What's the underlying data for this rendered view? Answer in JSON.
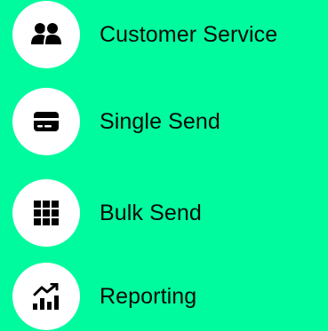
{
  "menu": {
    "items": [
      {
        "label": "Customer Service",
        "icon": "customer-service-icon"
      },
      {
        "label": "Single Send",
        "icon": "credit-card-icon"
      },
      {
        "label": "Bulk Send",
        "icon": "grid-icon"
      },
      {
        "label": "Reporting",
        "icon": "analytics-chart-icon"
      }
    ]
  },
  "colors": {
    "background": "#00FB9E",
    "icon_bg": "#FFFFFF",
    "icon_fg": "#000000",
    "text": "#0A0A0A"
  }
}
